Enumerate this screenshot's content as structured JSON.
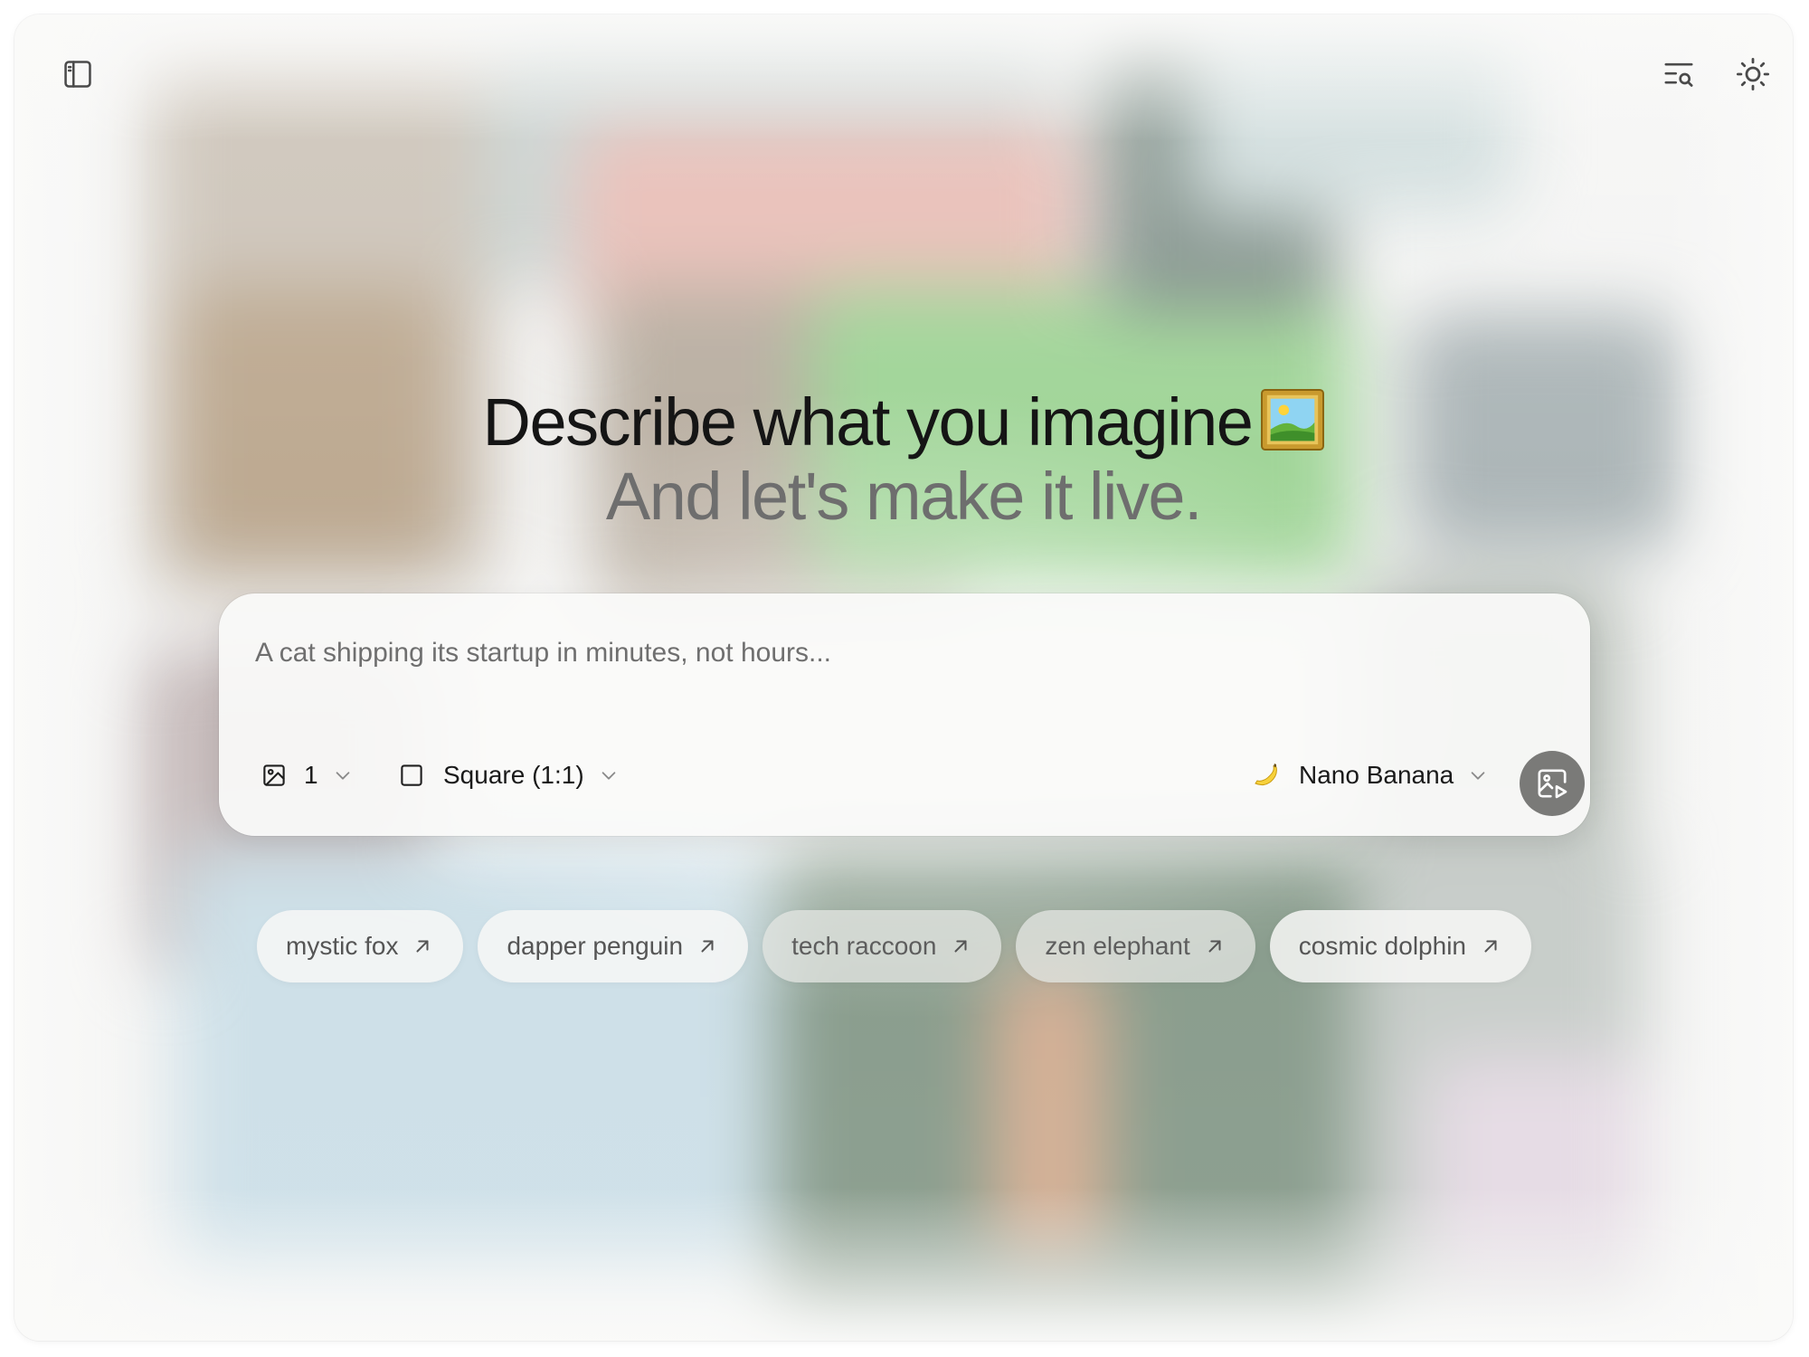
{
  "header": {
    "sidebar_toggle_icon": "sidebar-panel-icon",
    "search_icon": "list-search-icon",
    "theme_icon": "sun-icon"
  },
  "hero": {
    "title": "Describe what you imagine",
    "title_emoji": "framed-picture-emoji",
    "subtitle": "And let's make it live."
  },
  "prompt": {
    "placeholder": "A cat shipping its startup in minutes, not hours...",
    "value": "",
    "image_count": "1",
    "aspect_ratio": "Square (1:1)",
    "model": "Nano Banana",
    "model_icon": "banana-emoji",
    "submit_icon": "image-play-icon"
  },
  "suggestions": [
    {
      "label": "mystic fox"
    },
    {
      "label": "dapper penguin"
    },
    {
      "label": "tech raccoon"
    },
    {
      "label": "zen elephant"
    },
    {
      "label": "cosmic dolphin"
    }
  ],
  "colors": {
    "submit_button": "#7a7a78",
    "title_text": "#151515",
    "subtitle_text": "#6e6e6e"
  }
}
